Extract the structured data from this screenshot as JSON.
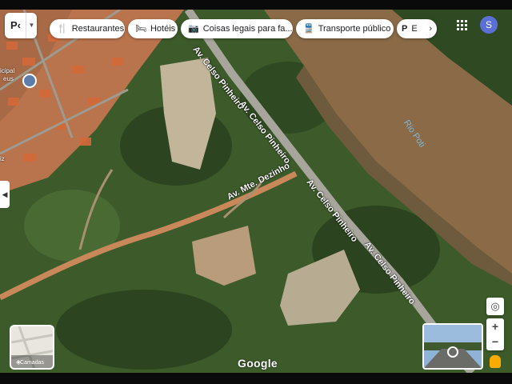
{
  "search": {
    "query": "P‹"
  },
  "chips": [
    {
      "icon": "restaurant-icon",
      "glyph": "🍴",
      "label": "Restaurantes"
    },
    {
      "icon": "hotel-icon",
      "glyph": "🛏",
      "label": "Hotéis"
    },
    {
      "icon": "camera-icon",
      "glyph": "📷",
      "label": "Coisas legais para fa..."
    },
    {
      "icon": "transit-icon",
      "glyph": "🚆",
      "label": "Transporte público"
    },
    {
      "icon": "parking-icon",
      "glyph": "P",
      "label": "E"
    }
  ],
  "user": {
    "initial": "S"
  },
  "layers": {
    "label": "Camadas"
  },
  "brand": "Google",
  "map_labels": {
    "road_1a": "Av. Celso Pinheiro",
    "road_1b": "Av. Celso Pinheiro",
    "road_1c": "Av. Celso Pinheiro",
    "road_1d": "Av. Celso Pinheiro",
    "road_2": "Av. Mte. Dezinho",
    "river": "Rio Poti",
    "poi_top": "icipal",
    "poi_top2": "eus",
    "poi_left": "iz"
  },
  "colors": {
    "river": "#8a6a47",
    "vegetation": "#3e5c2a",
    "roofs": "#c96a3a",
    "accent": "#1a73e8"
  }
}
